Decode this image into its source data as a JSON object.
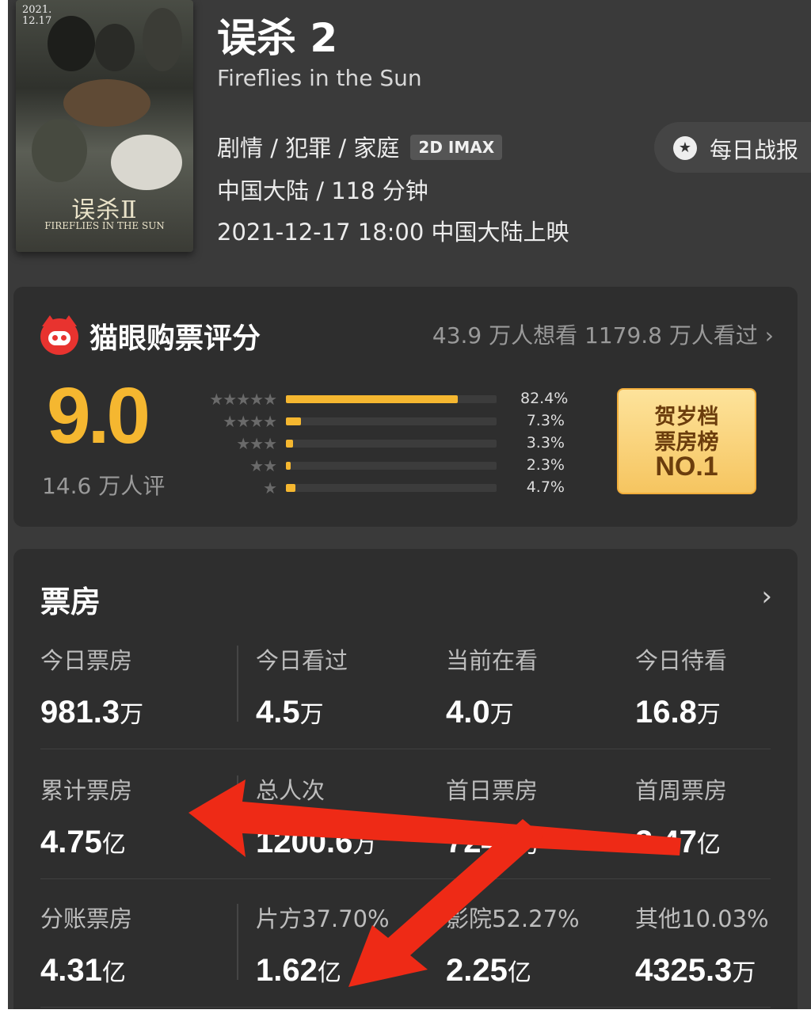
{
  "header": {
    "poster": {
      "date": "2021.\n12.17",
      "title": "误杀Ⅱ",
      "subtitle": "FIREFLIES IN THE SUN"
    },
    "title": "误杀 2",
    "english_title": "Fireflies in the Sun",
    "genres": "剧情 / 犯罪 / 家庭",
    "format_tag": "2D IMAX",
    "region_duration": "中国大陆 / 118 分钟",
    "release": "2021-12-17 18:00 中国大陆上映",
    "daily_report_label": "每日战报"
  },
  "rating": {
    "title": "猫眼购票评分",
    "want_seen": "43.9 万人想看  1179.8 万人看过  ›",
    "score": "9.0",
    "count": "14.6 万人评",
    "distribution": [
      {
        "stars": "★★★★★",
        "pct_label": "82.4%",
        "pct": 82.4
      },
      {
        "stars": "★★★★",
        "pct_label": "7.3%",
        "pct": 7.3
      },
      {
        "stars": "★★★",
        "pct_label": "3.3%",
        "pct": 3.3
      },
      {
        "stars": "★★",
        "pct_label": "2.3%",
        "pct": 2.3
      },
      {
        "stars": "★",
        "pct_label": "4.7%",
        "pct": 4.7
      }
    ],
    "badge": {
      "line1": "贺岁档",
      "line2": "票房榜",
      "line3": "NO.1"
    }
  },
  "box_office": {
    "title": "票房",
    "arrow": "›",
    "rows": [
      [
        {
          "label": "今日票房",
          "value": "981.3",
          "unit": "万"
        },
        {
          "label": "今日看过",
          "value": "4.5",
          "unit": "万"
        },
        {
          "label": "当前在看",
          "value": "4.0",
          "unit": "万"
        },
        {
          "label": "今日待看",
          "value": "16.8",
          "unit": "万"
        }
      ],
      [
        {
          "label": "累计票房",
          "value": "4.75",
          "unit": "亿"
        },
        {
          "label": "总人次",
          "value": "1200.6",
          "unit": "万"
        },
        {
          "label": "首日票房",
          "value": "7247",
          "unit": "万"
        },
        {
          "label": "首周票房",
          "value": "3.47",
          "unit": "亿"
        }
      ],
      [
        {
          "label": "分账票房",
          "value": "4.31",
          "unit": "亿"
        },
        {
          "label": "片方37.70%",
          "value": "1.62",
          "unit": "亿"
        },
        {
          "label": "影院52.27%",
          "value": "2.25",
          "unit": "亿"
        },
        {
          "label": "其他10.03%",
          "value": "4325.3",
          "unit": "万"
        }
      ]
    ]
  },
  "colors": {
    "accent": "#f5b730",
    "arrow": "#ee2a16",
    "card": "#2e2e2e",
    "background": "#3a3a3a"
  }
}
